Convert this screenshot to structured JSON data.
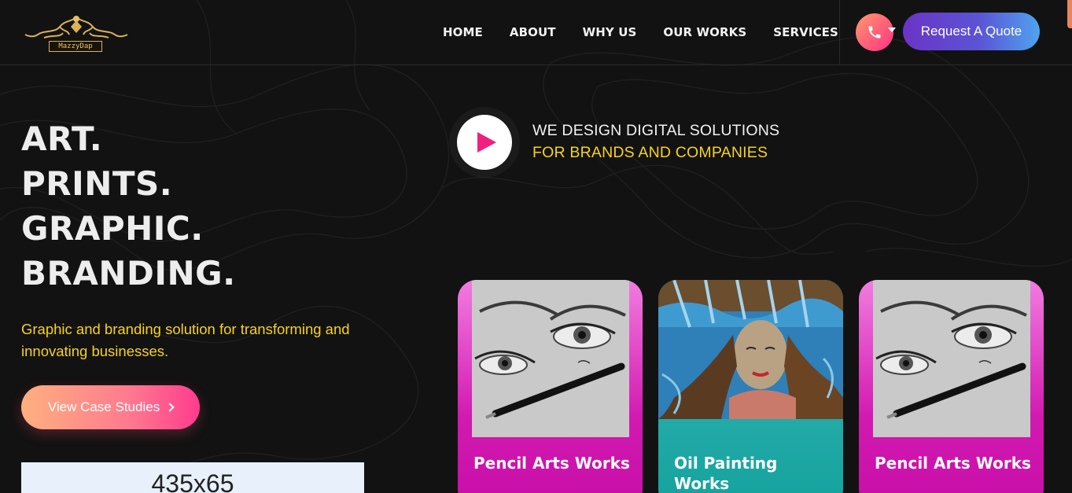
{
  "brand": {
    "logo_text": "MazzyDap"
  },
  "nav": {
    "items": [
      {
        "label": "HOME"
      },
      {
        "label": "ABOUT"
      },
      {
        "label": "WHY US"
      },
      {
        "label": "OUR WORKS"
      },
      {
        "label": "SERVICES"
      }
    ],
    "quote_label": "Request A Quote"
  },
  "hero": {
    "lines": [
      "ART.",
      "PRINTS.",
      "GRAPHIC.",
      "BRANDING."
    ],
    "subtitle": "Graphic and branding solution for transforming and innovating businesses.",
    "cta_label": "View Case Studies",
    "ad_placeholder": "435x65"
  },
  "tagline": {
    "line1": "WE DESIGN DIGITAL SOLUTIONS",
    "line2": "FOR BRANDS AND COMPANIES"
  },
  "cards": [
    {
      "title": "Pencil Arts Works",
      "icon": "pencil-portrait-image"
    },
    {
      "title": "Oil Painting Works",
      "icon": "oil-painting-image"
    },
    {
      "title": "Pencil Arts Works",
      "icon": "pencil-portrait-image"
    }
  ],
  "colors": {
    "background": "#121212",
    "accent_yellow": "#f6d31d",
    "accent_pink": "#f0207e",
    "quote_gradient": [
      "#6a34c6",
      "#4fa3ef"
    ],
    "cta_gradient": [
      "#ffb07f",
      "#ff3c8e"
    ]
  }
}
